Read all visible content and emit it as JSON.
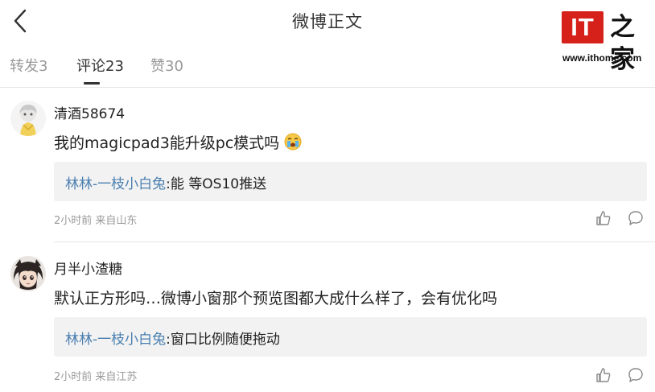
{
  "header": {
    "title": "微博正文",
    "logo_text": "IT之家",
    "logo_mark": "IT",
    "logo_word": "之家",
    "logo_url": "www.ithome.com"
  },
  "tabs": [
    {
      "label": "转发3",
      "active": false
    },
    {
      "label": "评论23",
      "active": true
    },
    {
      "label": "赞30",
      "active": false
    }
  ],
  "comments": [
    {
      "username": "清酒58674",
      "text": "我的magicpad3能升级pc模式吗",
      "emoji": "cry-face-icon",
      "reply": {
        "author": "林林-一枝小白兔",
        "sep": ":",
        "text": "能 等OS10推送"
      },
      "meta": "2小时前 来自山东"
    },
    {
      "username": "月半小渣糖",
      "text": "默认正方形吗…微博小窗那个预览图都大成什么样了，会有优化吗",
      "reply": {
        "author": "林林-一枝小白兔",
        "sep": ":",
        "text": "窗口比例随便拖动"
      },
      "meta": "2小时前 来自江苏"
    }
  ],
  "colors": {
    "link": "#4a7fb0",
    "reply_bg": "#f2f2f2",
    "logo_red": "#d6201a",
    "muted": "#999999"
  }
}
